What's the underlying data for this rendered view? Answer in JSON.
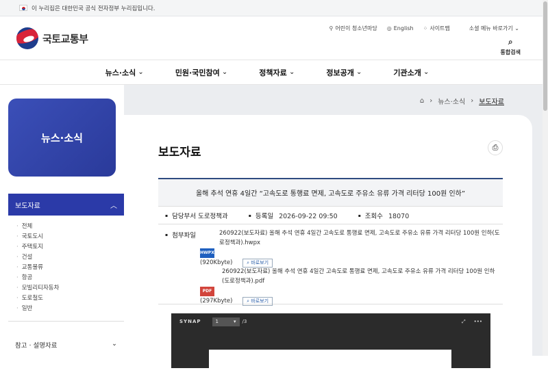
{
  "gov_banner": {
    "text": "이 누리집은 대한민국 공식 전자정부 누리집입니다."
  },
  "logo": {
    "text": "국토교통부"
  },
  "utility": {
    "kids": "어린이 청소년마당",
    "english": "English",
    "sitemap": "사이트맵",
    "social": "소셜 메뉴 바로가기",
    "search": "통합검색"
  },
  "gnb": [
    "뉴스·소식",
    "민원·국민참여",
    "정책자료",
    "정보공개",
    "기관소개"
  ],
  "breadcrumb": {
    "level1": "뉴스·소식",
    "current": "보도자료"
  },
  "lnb": {
    "hero": "뉴스·소식",
    "active": "보도자료",
    "items": [
      "전체",
      "국토도시",
      "주택토지",
      "건설",
      "교통물류",
      "항공",
      "모빌리티자동차",
      "도로철도",
      "일반"
    ],
    "next": "참고 · 설명자료"
  },
  "page": {
    "title": "보도자료"
  },
  "article": {
    "title": "올해 추석 연휴 4일간 “고속도로 통행료 면제, 고속도로 주유소 유류 가격 리터당 100원 인하”",
    "dept_label": "담당부서",
    "dept": "도로정책과",
    "date_label": "등록일",
    "date": "2026-09-22 09:50",
    "views_label": "조회수",
    "views": "18070",
    "files_label": "첨부파일",
    "files": [
      {
        "type": "HWPX",
        "name": "260922(보도자료) 올해 추석 연휴 4일간 고속도로 통행료 면제, 고속도로 주유소 유류 가격 리터당 100원 인하(도로정책과).hwpx",
        "size": "(920Kbyte)",
        "view": "바로보기"
      },
      {
        "type": "PDF",
        "name": "260922(보도자료) 올해 추석 연휴 4일간 고속도로 통행료 면제, 고속도로 주유소 유류 가격 리터당 100원 인하(도로정책과).pdf",
        "size": "(297Kbyte)",
        "view": "바로보기"
      }
    ]
  },
  "viewer": {
    "brand": "SYNAP",
    "page": "1",
    "total": "/3"
  }
}
